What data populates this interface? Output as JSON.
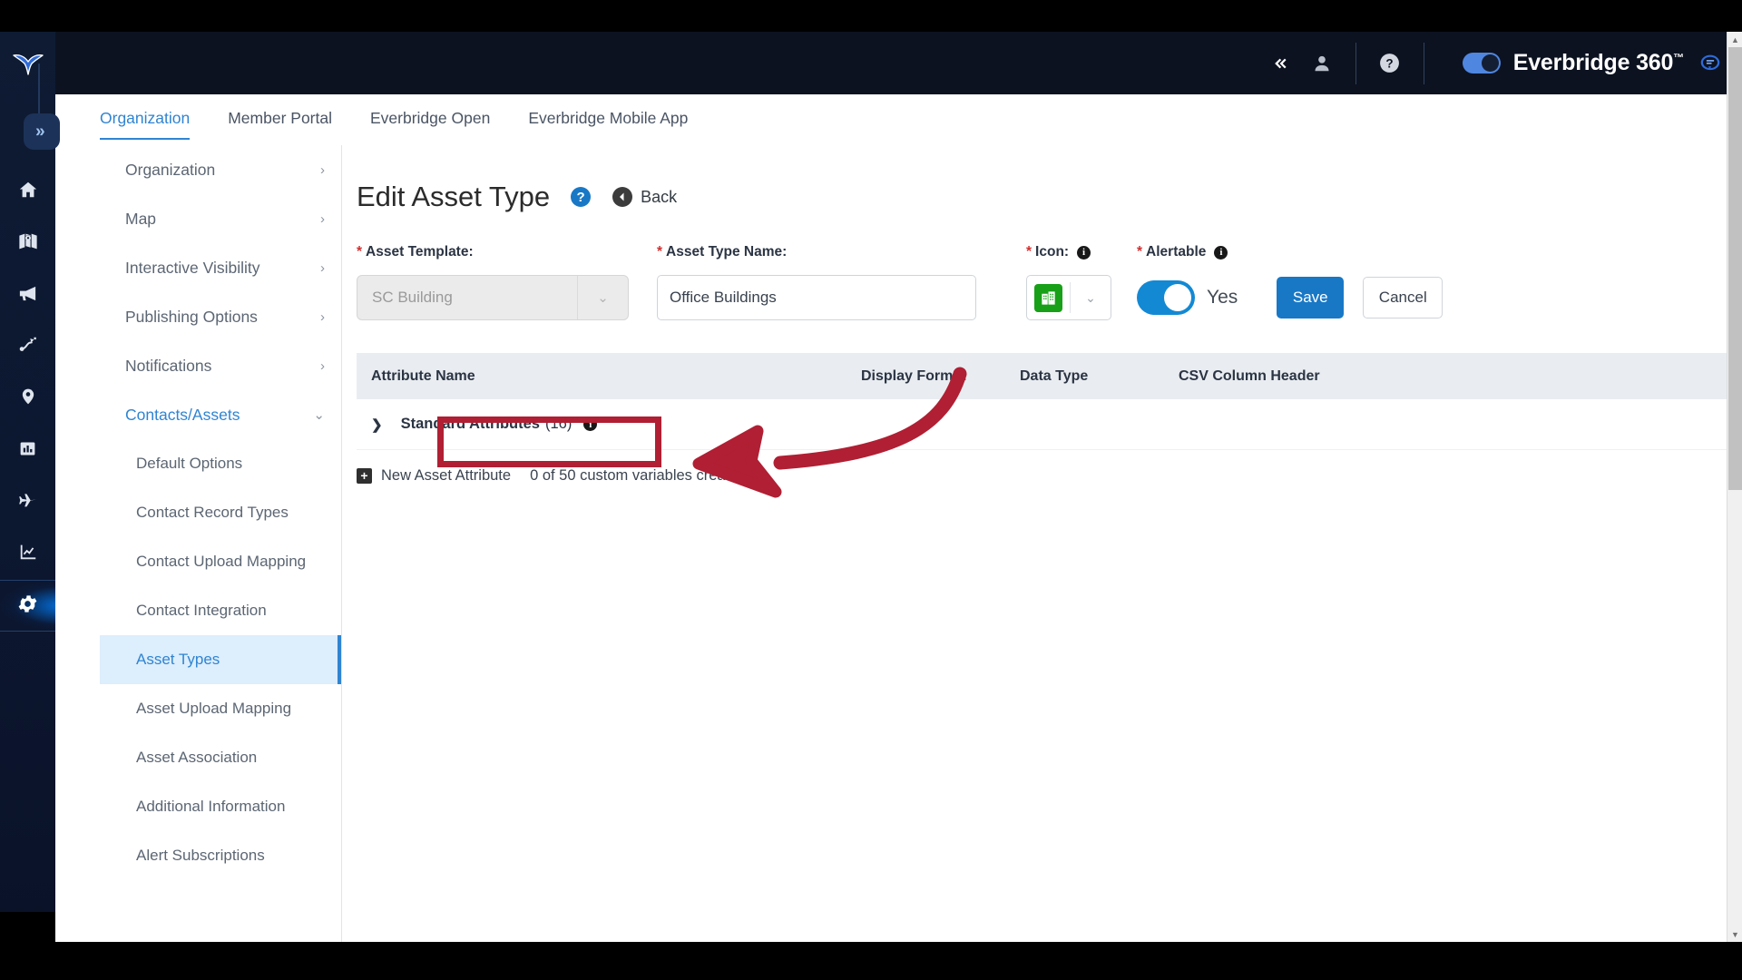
{
  "app": {
    "brand": "Everbridge 360",
    "brand_tm": "™"
  },
  "rail": {
    "logo_name": "everbridge-logo",
    "collapse_label": "«",
    "items": [
      {
        "name": "home-icon",
        "label": "Home"
      },
      {
        "name": "map-icon",
        "label": "Map"
      },
      {
        "name": "megaphone-icon",
        "label": "Notifications"
      },
      {
        "name": "incidents-icon",
        "label": "Incidents"
      },
      {
        "name": "location-pin-icon",
        "label": "Locations"
      },
      {
        "name": "reports-icon",
        "label": "Reports"
      },
      {
        "name": "travel-icon",
        "label": "Travel"
      },
      {
        "name": "analytics-icon",
        "label": "Analytics"
      },
      {
        "name": "gear-icon",
        "label": "Settings"
      }
    ]
  },
  "topbar": {
    "collapse_icon": "«",
    "user_icon": "person-icon",
    "help_icon": "question-icon",
    "chat_icon": "chat-icon"
  },
  "tabs": [
    {
      "label": "Organization",
      "active": true
    },
    {
      "label": "Member Portal",
      "active": false
    },
    {
      "label": "Everbridge Open",
      "active": false
    },
    {
      "label": "Everbridge Mobile App",
      "active": false
    }
  ],
  "submenu": [
    {
      "label": "Organization",
      "type": "expandable",
      "chevron": "›"
    },
    {
      "label": "Map",
      "type": "expandable",
      "chevron": "›"
    },
    {
      "label": "Interactive Visibility",
      "type": "expandable",
      "chevron": "›"
    },
    {
      "label": "Publishing Options",
      "type": "expandable",
      "chevron": "›"
    },
    {
      "label": "Notifications",
      "type": "expandable",
      "chevron": "›"
    },
    {
      "label": "Contacts/Assets",
      "type": "expandable-open",
      "chevron": "⌄"
    },
    {
      "label": "Default Options",
      "type": "child"
    },
    {
      "label": "Contact Record Types",
      "type": "child"
    },
    {
      "label": "Contact Upload Mapping",
      "type": "child"
    },
    {
      "label": "Contact Integration",
      "type": "child"
    },
    {
      "label": "Asset Types",
      "type": "child-active"
    },
    {
      "label": "Asset Upload Mapping",
      "type": "child"
    },
    {
      "label": "Asset Association",
      "type": "child"
    },
    {
      "label": "Additional Information",
      "type": "child"
    },
    {
      "label": "Alert Subscriptions",
      "type": "child"
    }
  ],
  "page": {
    "title": "Edit Asset Type",
    "help_badge": "?",
    "back_label": "Back",
    "back_icon": "◄"
  },
  "form": {
    "asset_template": {
      "label": "Asset Template:",
      "required": "*",
      "value": "SC Building",
      "disabled": true,
      "caret": "⌄"
    },
    "asset_type_name": {
      "label": "Asset Type Name:",
      "required": "*",
      "value": "Office Buildings"
    },
    "icon": {
      "label": "Icon:",
      "required": "*",
      "info": "i",
      "swatch_color": "#18a018",
      "caret": "⌄"
    },
    "alertable": {
      "label": "Alertable",
      "required": "*",
      "info": "i",
      "state": "Yes",
      "on": true
    },
    "save_label": "Save",
    "cancel_label": "Cancel"
  },
  "table": {
    "headers": [
      "Attribute Name",
      "Display Format",
      "Data Type",
      "CSV Column Header"
    ],
    "standard_attributes": {
      "label": "Standard Attributes",
      "count": "(16)",
      "chevron": "❯",
      "info": "i"
    },
    "new_attribute": {
      "plus": "+",
      "label": "New Asset Attribute",
      "custom_count": "0 of 50 custom variables created"
    }
  },
  "annotation": {
    "highlight_color": "#b01f33",
    "arrow_name": "red-curved-arrow",
    "box_name": "red-highlight-box"
  },
  "scrollbar": {
    "up_arrow": "▲",
    "down_arrow": "▼"
  }
}
